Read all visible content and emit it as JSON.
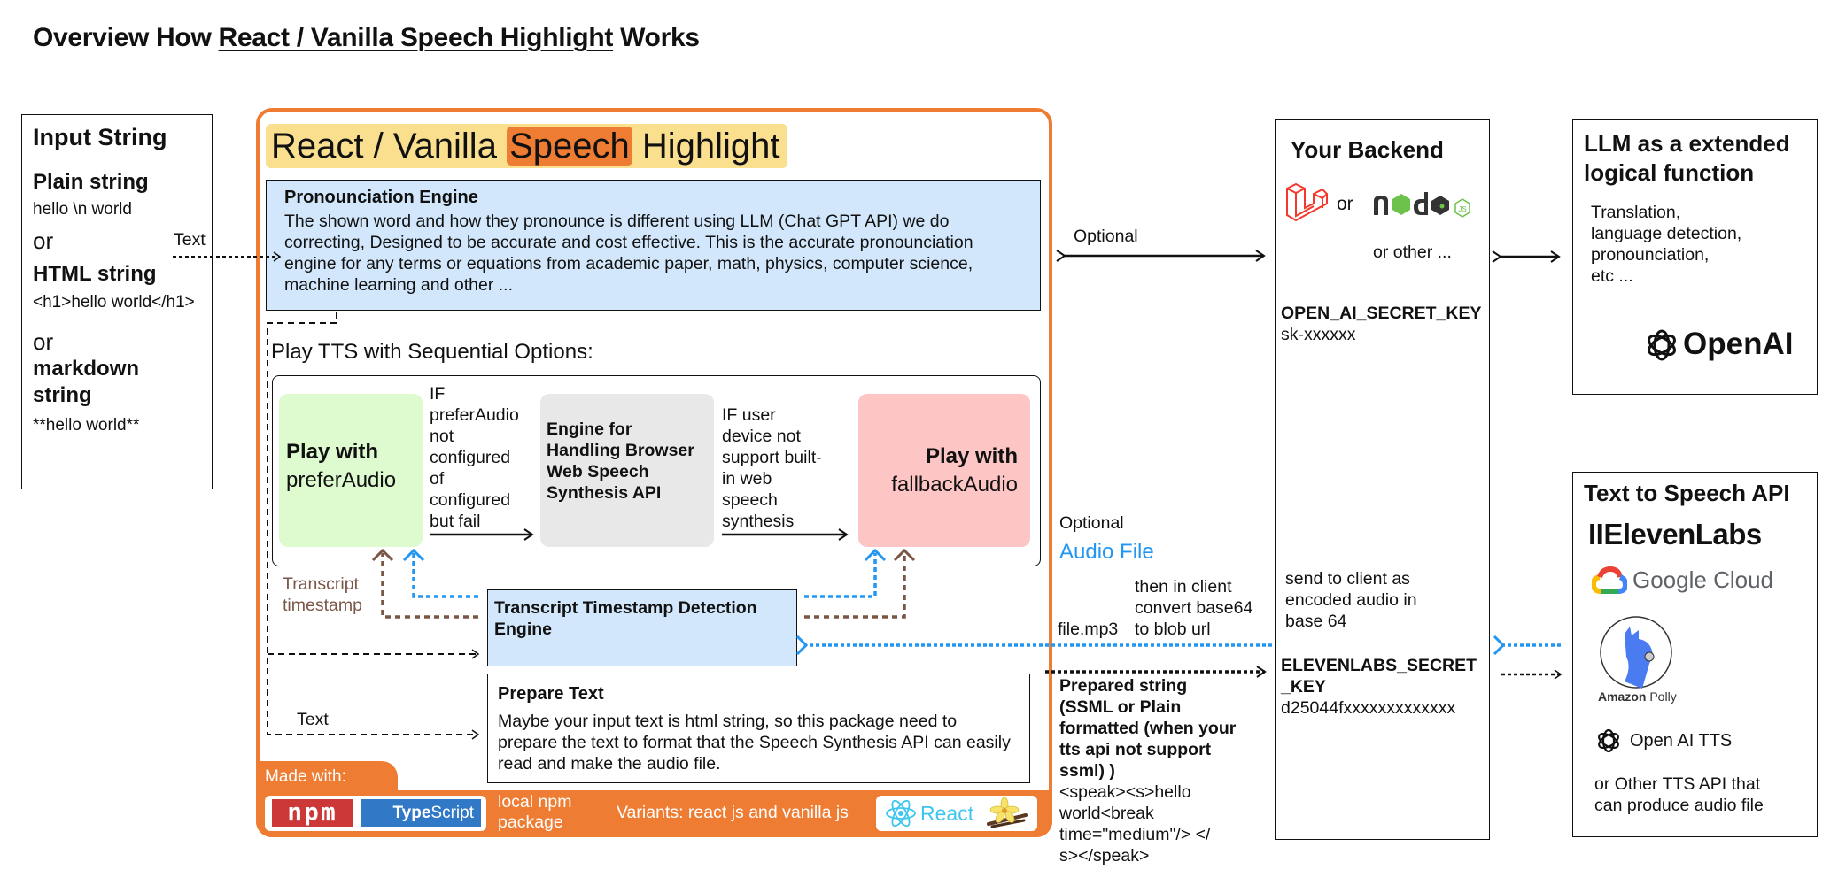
{
  "page_title": {
    "prefix": "Overview How ",
    "underlined": "React / Vanilla Speech Highlight",
    "suffix": " Works"
  },
  "input_string": {
    "title": "Input String",
    "plain_label": "Plain string",
    "plain_example": "hello \\n world",
    "or1": "or",
    "html_label": "HTML string",
    "html_example": "<h1>hello world</h1>",
    "or2": "or",
    "markdown_label_1": "markdown",
    "markdown_label_2": "string",
    "markdown_example": "**hello world**",
    "arrow_label": "Text"
  },
  "package": {
    "title_part1": "React / Vanilla ",
    "title_highlight": "Speech",
    "title_part2": " Highlight",
    "pronounciation": {
      "title": "Pronounciation Engine",
      "body": "The shown word and how they pronounce is different using LLM (Chat GPT API) we do correcting, Designed to be accurate and cost effective. This is the accurate pronounciation engine for any terms or equations from academic paper, math, physics, computer science, machine learning and other ..."
    },
    "play_label": "Play TTS with Sequential Options:",
    "prefer_audio": {
      "bold": "Play with",
      "normal": "preferAudio"
    },
    "condition1": [
      "IF",
      "preferAudio",
      "not",
      "configured",
      "of",
      "configured",
      "but fail"
    ],
    "browser_engine": [
      "Engine for",
      "Handling Browser",
      "Web Speech",
      "Synthesis API"
    ],
    "condition2": [
      "IF user",
      "device not",
      "support built-",
      "in web",
      "speech",
      "synthesis"
    ],
    "fallback_audio": {
      "bold": "Play with",
      "normal": "fallbackAudio"
    },
    "transcript_label": [
      "Transcript",
      "timestamp"
    ],
    "transcript_engine": "Transcript Timestamp Detection Engine",
    "prepare_text": {
      "title": "Prepare Text",
      "body": "Maybe your input text is html string, so this package need to prepare the text to format that the Speech Synthesis API can easily read and make the audio file."
    },
    "text_arrow_label": "Text",
    "made_with": "Made with:",
    "npm_logo": "npm",
    "ts_logo_bold": "Type",
    "ts_logo_normal": "Script",
    "local_npm": [
      "local npm",
      "package"
    ],
    "variants": "Variants: react js and vanilla js",
    "react_logo": "React"
  },
  "middle": {
    "optional_top": "Optional",
    "optional_audio": "Optional",
    "audio_file": "Audio File",
    "client_convert": [
      "then in client",
      "convert base64",
      "to blob url"
    ],
    "file_name": "file.mp3",
    "prepared_string": [
      "Prepared string",
      "(SSML or Plain",
      "formatted (when your",
      "tts api not support",
      "ssml) )"
    ],
    "ssml_example": [
      "<speak><s>hello",
      "world<break",
      "time=\"medium\"/> </",
      "s></speak>"
    ]
  },
  "backend": {
    "title": "Your Backend",
    "or": "or",
    "node_logo": "node",
    "or_other": "or other ...",
    "openai_key_label": "OPEN_AI_SECRET_KEY",
    "openai_key_value": "sk-xxxxxx",
    "send_to_client": [
      "send to client as",
      "encoded audio in",
      "base 64"
    ],
    "eleven_key_label": [
      "ELEVENLABS_SECRET",
      "_KEY"
    ],
    "eleven_key_value": "d25044fxxxxxxxxxxxxx"
  },
  "llm": {
    "title": [
      "LLM as a extended",
      "logical function"
    ],
    "items": [
      "Translation,",
      "language detection,",
      "pronounciation,",
      "etc ..."
    ],
    "logo": "OpenAI"
  },
  "tts": {
    "title": "Text to Speech API",
    "elevenlabs": "IIElevenLabs",
    "google": "Google Cloud",
    "polly_bold": "Amazon",
    "polly_normal": " Polly",
    "openai_tts": "Open AI TTS",
    "other": [
      "or Other TTS API that",
      "can produce audio file"
    ]
  },
  "colors": {
    "orange": "#ee7d33",
    "title_pill": "#fadf8f",
    "engine_blue": "#d2e7fb",
    "prefer_green": "#defbd0",
    "engine_gray": "#e8e8e8",
    "fallback_pink": "#fec5c5",
    "audio_blue": "#2196f3",
    "transcript_brown": "#7a5646",
    "npm_red": "#cb3837",
    "ts_blue": "#3178c6",
    "laravel_red": "#f4392c",
    "node_green": "#6cc24a"
  }
}
